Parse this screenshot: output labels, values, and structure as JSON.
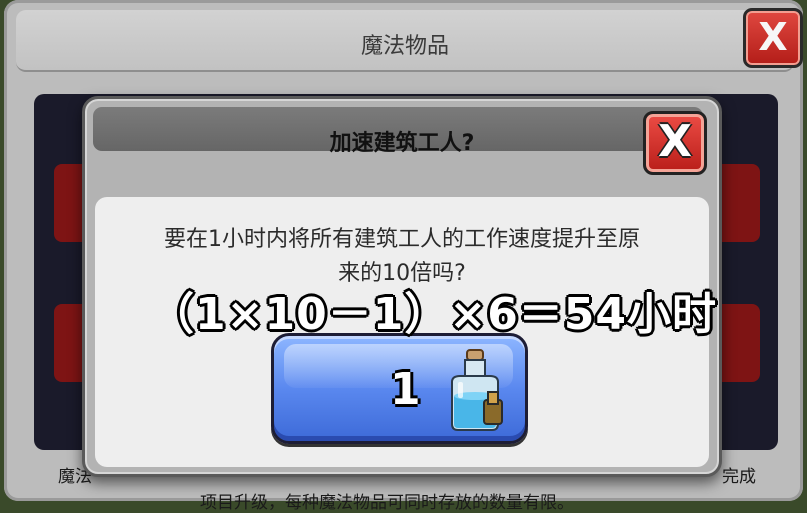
{
  "background_window": {
    "title": "魔法物品",
    "close_glyph": "X",
    "left_caption": "魔法",
    "right_caption": "完成",
    "bottom_text": "项目升级，每种魔法物品可同时存放的数量有限。"
  },
  "dialog": {
    "title": "加速建筑工人?",
    "close_glyph": "X",
    "prompt_line1": "要在1小时内将所有建筑工人的工作速度提升至原",
    "prompt_line2": "来的10倍吗?",
    "overlay_formula": "（1×10－1）×6＝54小时",
    "confirm_button": {
      "count": "1",
      "icon": "builder-potion-icon"
    }
  },
  "colors": {
    "close_red": "#c9251f",
    "button_blue": "#5a88ef",
    "dialog_gray": "#b3b3b3"
  }
}
